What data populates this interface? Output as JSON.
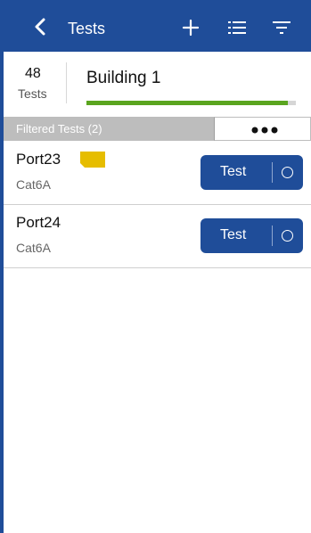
{
  "header": {
    "title": "Tests",
    "icons": [
      "back-chevron-icon",
      "add-icon",
      "list-icon",
      "filter-icon"
    ]
  },
  "summary": {
    "count": "48",
    "count_label": "Tests",
    "location": "Building 1",
    "progress_fraction": 0.96
  },
  "filter_bar": {
    "label": "Filtered Tests (2)",
    "more_icon": "more-horizontal-icon"
  },
  "tests": [
    {
      "name": "Port23",
      "cable": "Cat6A",
      "flagged": true,
      "button_label": "Test"
    },
    {
      "name": "Port24",
      "cable": "Cat6A",
      "flagged": false,
      "button_label": "Test"
    }
  ],
  "colors": {
    "brand": "#1f4d99",
    "progress": "#5aa51f",
    "flag": "#e6bd00",
    "filter_bar": "#bdbdbd"
  }
}
